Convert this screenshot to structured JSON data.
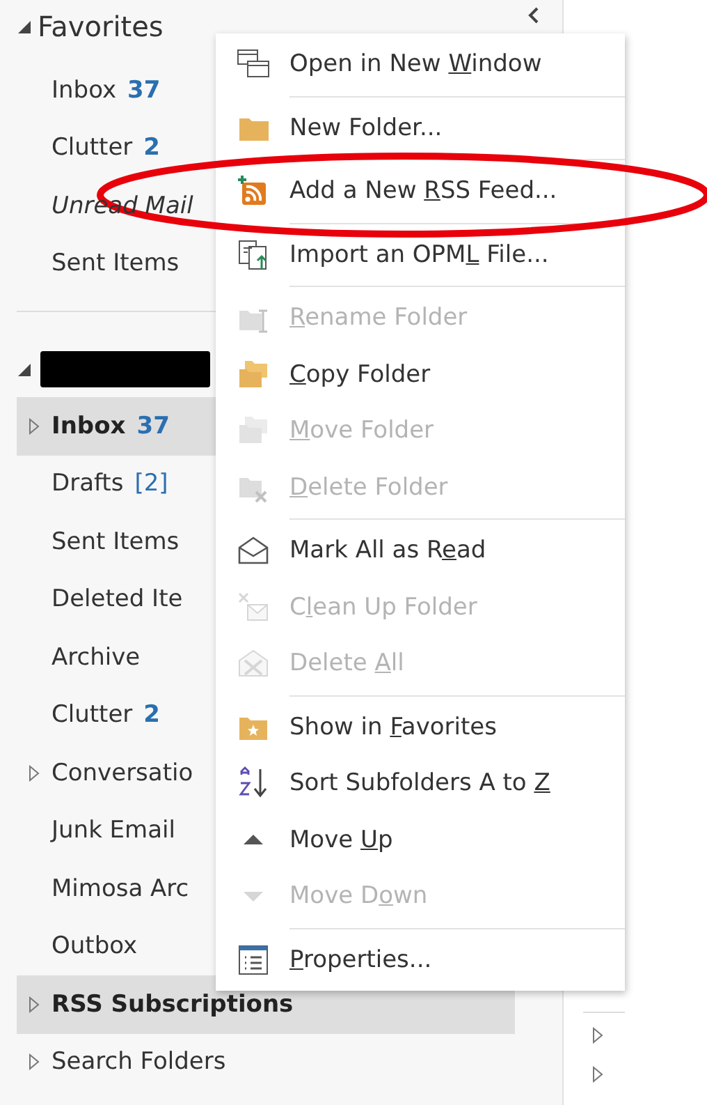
{
  "favorites": {
    "label": "Favorites",
    "expanded": true,
    "items": [
      {
        "label": "Inbox",
        "count": "37",
        "count_bold": true,
        "italic": false
      },
      {
        "label": "Clutter",
        "count": "2",
        "count_bold": true,
        "italic": false
      },
      {
        "label": "Unread Mail",
        "italic": true
      },
      {
        "label": "Sent Items",
        "italic": false
      }
    ]
  },
  "account": {
    "redacted": true,
    "expanded": true,
    "folders": [
      {
        "label": "Inbox",
        "count": "37",
        "count_bold": true,
        "bold": true,
        "selected": true,
        "expandable": true
      },
      {
        "label": "Drafts",
        "count": "[2]",
        "count_bold": false,
        "bold": false,
        "selected": false,
        "expandable": false
      },
      {
        "label": "Sent Items",
        "bold": false,
        "selected": false,
        "expandable": false
      },
      {
        "label": "Deleted Ite",
        "bold": false,
        "selected": false,
        "expandable": false
      },
      {
        "label": "Archive",
        "bold": false,
        "selected": false,
        "expandable": false
      },
      {
        "label": "Clutter",
        "count": "2",
        "count_bold": true,
        "bold": false,
        "selected": false,
        "expandable": false
      },
      {
        "label": "Conversatio",
        "bold": false,
        "selected": false,
        "expandable": true
      },
      {
        "label": "Junk Email",
        "bold": false,
        "selected": false,
        "expandable": false
      },
      {
        "label": "Mimosa Arc",
        "bold": false,
        "selected": false,
        "expandable": false
      },
      {
        "label": "Outbox",
        "bold": false,
        "selected": false,
        "expandable": false
      },
      {
        "label": "RSS Subscriptions",
        "bold": true,
        "selected": true,
        "expandable": true
      },
      {
        "label": "Search Folders",
        "bold": false,
        "selected": false,
        "expandable": true
      }
    ]
  },
  "context_menu": {
    "sections": [
      [
        {
          "kind": "window",
          "before": "Open in New ",
          "key": "W",
          "after": "indow",
          "disabled": false
        }
      ],
      [
        {
          "kind": "folder",
          "before": "New Folder...",
          "disabled": false
        }
      ],
      [
        {
          "kind": "rss",
          "before": "Add a New ",
          "key": "R",
          "after": "SS Feed...",
          "disabled": false
        }
      ],
      [
        {
          "kind": "import",
          "before": "Import an OPM",
          "key": "L",
          "after": " File...",
          "disabled": false
        }
      ],
      [
        {
          "kind": "rename",
          "key": "R",
          "after": "ename Folder",
          "disabled": true
        },
        {
          "kind": "copy",
          "key": "C",
          "after": "opy Folder",
          "disabled": false
        },
        {
          "kind": "move",
          "key": "M",
          "after": "ove Folder",
          "disabled": true
        },
        {
          "kind": "delete-folder",
          "key": "D",
          "after": "elete Folder",
          "disabled": true
        }
      ],
      [
        {
          "kind": "envelope",
          "before": "Mark All as R",
          "key": "e",
          "after": "ad",
          "disabled": false
        },
        {
          "kind": "cleanup",
          "before": "C",
          "key": "l",
          "after": "ean Up Folder",
          "disabled": true
        },
        {
          "kind": "delete-all",
          "before": "Delete ",
          "key": "A",
          "after": "ll",
          "disabled": true
        }
      ],
      [
        {
          "kind": "favorite",
          "before": "Show in ",
          "key": "F",
          "after": "avorites",
          "disabled": false
        },
        {
          "kind": "sort",
          "before": "Sort Subfolders A to ",
          "key": "Z",
          "disabled": false
        },
        {
          "kind": "up",
          "before": "Move ",
          "key": "U",
          "after": "p",
          "disabled": false
        },
        {
          "kind": "down",
          "before": "Move D",
          "key": "o",
          "after": "wn",
          "disabled": true
        }
      ],
      [
        {
          "kind": "properties",
          "key": "P",
          "after": "roperties...",
          "disabled": false
        }
      ]
    ]
  },
  "annotations": [
    {
      "kind": "ellipse",
      "color": "#e8000b"
    }
  ]
}
